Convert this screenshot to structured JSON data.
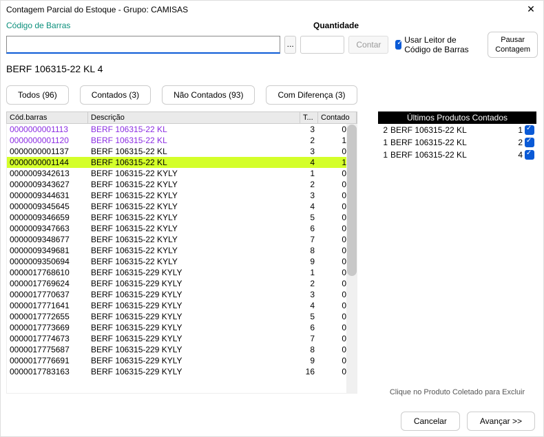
{
  "window": {
    "title": "Contagem Parcial do Estoque - Grupo: CAMISAS",
    "close": "✕"
  },
  "labels": {
    "barcode": "Código de Barras",
    "quantity": "Quantidade",
    "browse": "...",
    "contar": "Contar",
    "useReader": "Usar Leitor de Código de Barras",
    "pausar": "Pausar\nContagem"
  },
  "status": "BERF 106315-22 KL  4",
  "tabs": {
    "all": "Todos (96)",
    "counted": "Contados (3)",
    "notCounted": "Não Contados (93)",
    "diff": "Com Diferença (3)"
  },
  "table": {
    "headers": {
      "barcode": "Cód.barras",
      "desc": "Descrição",
      "t": "T...",
      "counted": "Contado"
    },
    "rows": [
      {
        "b": "0000000001113",
        "d": "BERF 106315-22 KL",
        "t": "3",
        "c": "0",
        "diff": true
      },
      {
        "b": "0000000001120",
        "d": "BERF 106315-22 KL",
        "t": "2",
        "c": "1",
        "diff": true
      },
      {
        "b": "0000000001137",
        "d": "BERF 106315-22 KL",
        "t": "3",
        "c": "0"
      },
      {
        "b": "0000000001144",
        "d": "BERF 106315-22 KL",
        "t": "4",
        "c": "1",
        "sel": true
      },
      {
        "b": "0000009342613",
        "d": "BERF 106315-22 KYLY",
        "t": "1",
        "c": "0"
      },
      {
        "b": "0000009343627",
        "d": "BERF 106315-22 KYLY",
        "t": "2",
        "c": "0"
      },
      {
        "b": "0000009344631",
        "d": "BERF 106315-22 KYLY",
        "t": "3",
        "c": "0"
      },
      {
        "b": "0000009345645",
        "d": "BERF 106315-22 KYLY",
        "t": "4",
        "c": "0"
      },
      {
        "b": "0000009346659",
        "d": "BERF 106315-22 KYLY",
        "t": "5",
        "c": "0"
      },
      {
        "b": "0000009347663",
        "d": "BERF 106315-22 KYLY",
        "t": "6",
        "c": "0"
      },
      {
        "b": "0000009348677",
        "d": "BERF 106315-22 KYLY",
        "t": "7",
        "c": "0"
      },
      {
        "b": "0000009349681",
        "d": "BERF 106315-22 KYLY",
        "t": "8",
        "c": "0"
      },
      {
        "b": "0000009350694",
        "d": "BERF 106315-22 KYLY",
        "t": "9",
        "c": "0"
      },
      {
        "b": "0000017768610",
        "d": "BERF 106315-229 KYLY",
        "t": "1",
        "c": "0"
      },
      {
        "b": "0000017769624",
        "d": "BERF 106315-229 KYLY",
        "t": "2",
        "c": "0"
      },
      {
        "b": "0000017770637",
        "d": "BERF 106315-229 KYLY",
        "t": "3",
        "c": "0"
      },
      {
        "b": "0000017771641",
        "d": "BERF 106315-229 KYLY",
        "t": "4",
        "c": "0"
      },
      {
        "b": "0000017772655",
        "d": "BERF 106315-229 KYLY",
        "t": "5",
        "c": "0"
      },
      {
        "b": "0000017773669",
        "d": "BERF 106315-229 KYLY",
        "t": "6",
        "c": "0"
      },
      {
        "b": "0000017774673",
        "d": "BERF 106315-229 KYLY",
        "t": "7",
        "c": "0"
      },
      {
        "b": "0000017775687",
        "d": "BERF 106315-229 KYLY",
        "t": "8",
        "c": "0"
      },
      {
        "b": "0000017776691",
        "d": "BERF 106315-229 KYLY",
        "t": "9",
        "c": "0"
      },
      {
        "b": "0000017783163",
        "d": "BERF 106315-229 KYLY",
        "t": "16",
        "c": "0"
      }
    ]
  },
  "recent": {
    "title": "Últimos Produtos Contados",
    "rows": [
      {
        "q": "2",
        "d": "BERF 106315-22 KL",
        "n": "1"
      },
      {
        "q": "1",
        "d": "BERF 106315-22 KL",
        "n": "2"
      },
      {
        "q": "1",
        "d": "BERF 106315-22 KL",
        "n": "4"
      }
    ],
    "hint": "Clique no Produto Coletado para Excluir"
  },
  "footer": {
    "cancel": "Cancelar",
    "next": "Avançar >>"
  }
}
